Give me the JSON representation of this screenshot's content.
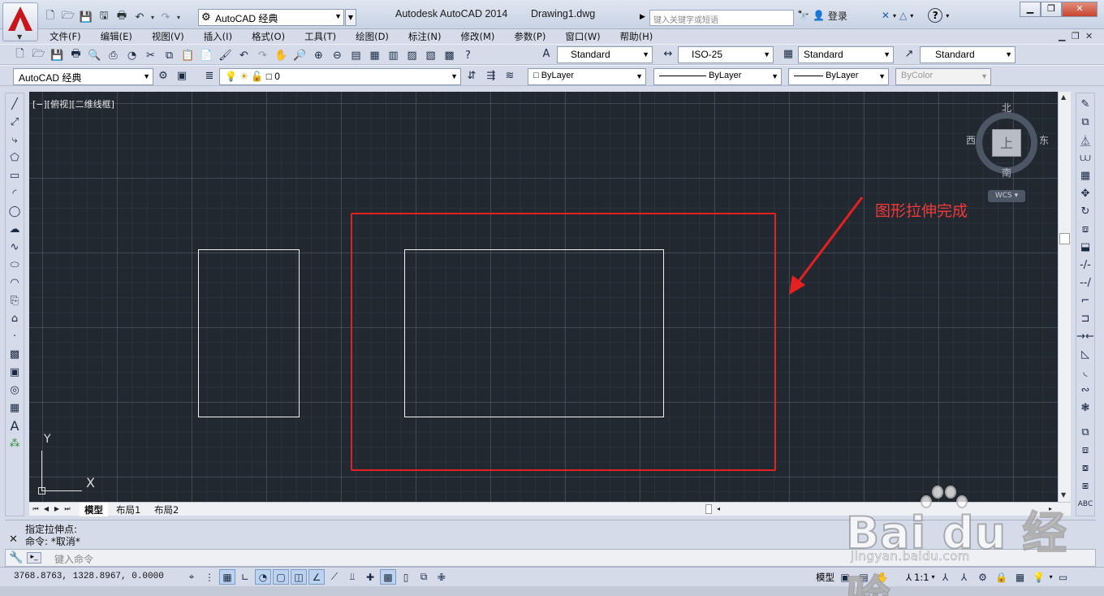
{
  "titlebar": {
    "workspace": "AutoCAD 经典",
    "app_title": "Autodesk AutoCAD 2014",
    "doc_title": "Drawing1.dwg",
    "search_placeholder": "键入关键字或短语",
    "login": "登录"
  },
  "menubar": {
    "items": [
      "文件(F)",
      "编辑(E)",
      "视图(V)",
      "插入(I)",
      "格式(O)",
      "工具(T)",
      "绘图(D)",
      "标注(N)",
      "修改(M)",
      "参数(P)",
      "窗口(W)",
      "帮助(H)"
    ]
  },
  "styles_toolbar": {
    "text_style": "Standard",
    "dim_style": "ISO-25",
    "table_style": "Standard",
    "mleader_style": "Standard"
  },
  "layers_toolbar": {
    "workspace": "AutoCAD 经典",
    "layer": "0",
    "color": "ByLayer",
    "linetype": "ByLayer",
    "lineweight": "ByLayer",
    "plotstyle": "ByColor"
  },
  "viewport": {
    "label": "[−][俯视][二维线框]"
  },
  "viewcube": {
    "north": "北",
    "south": "南",
    "east": "东",
    "west": "西",
    "face": "上",
    "wcs": "WCS"
  },
  "annotation": {
    "text": "图形拉伸完成",
    "color": "#e62020"
  },
  "ucs": {
    "x": "X",
    "y": "Y"
  },
  "layout_tabs": [
    "模型",
    "布局1",
    "布局2"
  ],
  "command": {
    "history": [
      "指定拉伸点:",
      "命令: *取消*"
    ],
    "placeholder": "键入命令"
  },
  "statusbar": {
    "coords": "3768.8763, 1328.8967, 0.0000",
    "model": "模型",
    "scale": "1:1"
  },
  "watermark": {
    "text": "Bai du 经验",
    "url": "jingyan.baidu.com"
  }
}
